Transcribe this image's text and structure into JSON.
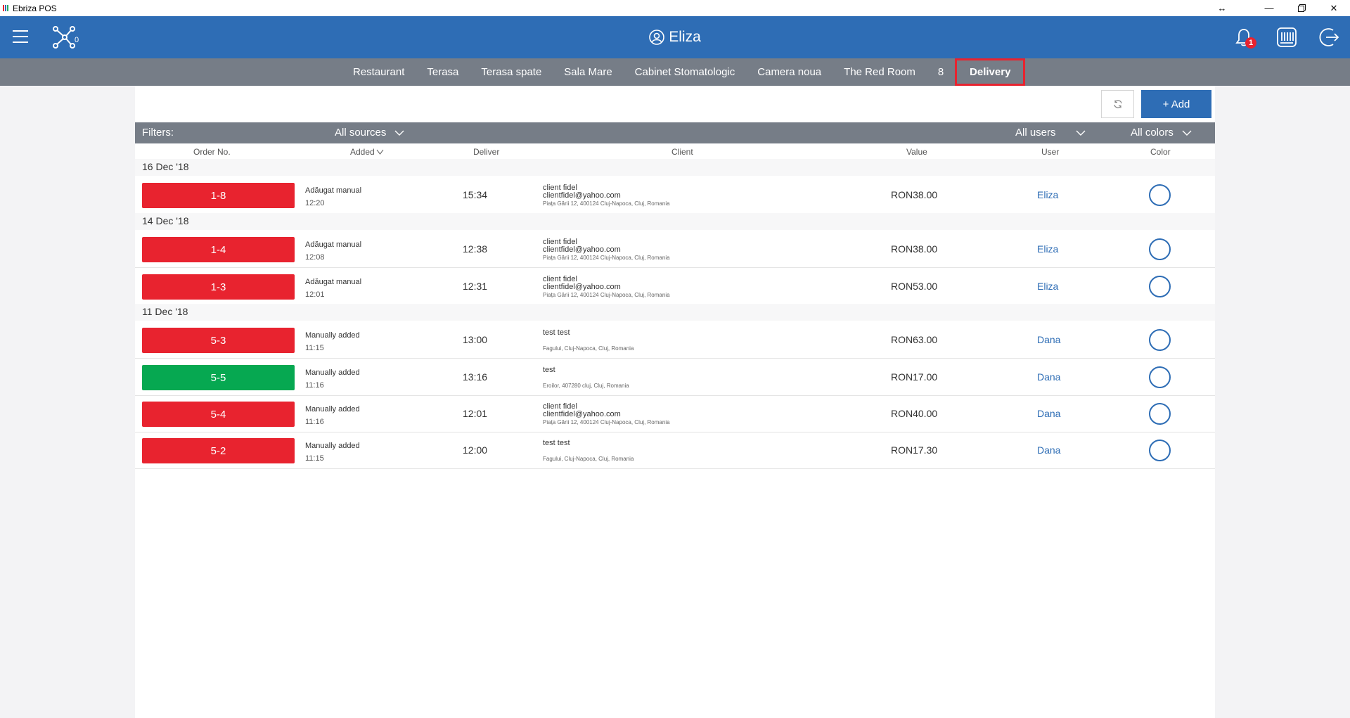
{
  "window": {
    "title": "Ebriza POS",
    "logo_colors": [
      "#e8232f",
      "#2e6db5",
      "#27ae60"
    ],
    "controls": [
      "resize-icon",
      "minimize-icon",
      "restore-icon",
      "close-icon"
    ]
  },
  "header": {
    "user_name": "Eliza",
    "notification_count": "1",
    "icons": [
      "menu-icon",
      "network-icon",
      "user-icon",
      "bell-icon",
      "keyboard-icon",
      "logout-icon"
    ]
  },
  "tabs": [
    {
      "label": "Restaurant"
    },
    {
      "label": "Terasa"
    },
    {
      "label": "Terasa spate"
    },
    {
      "label": "Sala Mare"
    },
    {
      "label": "Cabinet Stomatologic"
    },
    {
      "label": "Camera noua"
    },
    {
      "label": "The Red Room"
    },
    {
      "label": "8"
    },
    {
      "label": "Delivery",
      "active": true
    }
  ],
  "toolbar": {
    "add_label": "+ Add"
  },
  "filters": {
    "label": "Filters:",
    "sources": "All sources",
    "users": "All users",
    "colors": "All colors"
  },
  "columns": {
    "order_no": "Order No.",
    "added": "Added",
    "deliver": "Deliver",
    "client": "Client",
    "value": "Value",
    "user": "User",
    "color": "Color"
  },
  "colors": {
    "red": "#e8232f",
    "green": "#06a851",
    "blue": "#2e6db5"
  },
  "groups": [
    {
      "date": "16 Dec '18",
      "orders": [
        {
          "no": "1-8",
          "status": "red",
          "added_by": "Adăugat manual",
          "added_time": "12:20",
          "deliver": "15:34",
          "client_name": "client fidel",
          "client_email": "clientfidel@yahoo.com",
          "client_address": "Piața Gării 12, 400124 Cluj-Napoca, Cluj, Romania",
          "value": "RON38.00",
          "user": "Eliza"
        }
      ]
    },
    {
      "date": "14 Dec '18",
      "orders": [
        {
          "no": "1-4",
          "status": "red",
          "added_by": "Adăugat manual",
          "added_time": "12:08",
          "deliver": "12:38",
          "client_name": "client fidel",
          "client_email": "clientfidel@yahoo.com",
          "client_address": "Piața Gării 12, 400124 Cluj-Napoca, Cluj, Romania",
          "value": "RON38.00",
          "user": "Eliza"
        },
        {
          "no": "1-3",
          "status": "red",
          "added_by": "Adăugat manual",
          "added_time": "12:01",
          "deliver": "12:31",
          "client_name": "client fidel",
          "client_email": "clientfidel@yahoo.com",
          "client_address": "Piața Gării 12, 400124 Cluj-Napoca, Cluj, Romania",
          "value": "RON53.00",
          "user": "Eliza"
        }
      ]
    },
    {
      "date": "11 Dec '18",
      "orders": [
        {
          "no": "5-3",
          "status": "red",
          "added_by": "Manually added",
          "added_time": "11:15",
          "deliver": "13:00",
          "client_name": "test test",
          "client_email": "",
          "client_address": "Fagului, Cluj-Napoca, Cluj, Romania",
          "value": "RON63.00",
          "user": "Dana"
        },
        {
          "no": "5-5",
          "status": "green",
          "added_by": "Manually added",
          "added_time": "11:16",
          "deliver": "13:16",
          "client_name": "test",
          "client_email": "",
          "client_address": "Eroilor, 407280 cluj, Cluj, Romania",
          "value": "RON17.00",
          "user": "Dana"
        },
        {
          "no": "5-4",
          "status": "red",
          "added_by": "Manually added",
          "added_time": "11:16",
          "deliver": "12:01",
          "client_name": "client fidel",
          "client_email": "clientfidel@yahoo.com",
          "client_address": "Piața Gării 12, 400124 Cluj-Napoca, Cluj, Romania",
          "value": "RON40.00",
          "user": "Dana"
        },
        {
          "no": "5-2",
          "status": "red",
          "added_by": "Manually added",
          "added_time": "11:15",
          "deliver": "12:00",
          "client_name": "test test",
          "client_email": "",
          "client_address": "Fagului, Cluj-Napoca, Cluj, Romania",
          "value": "RON17.30",
          "user": "Dana"
        }
      ]
    }
  ]
}
